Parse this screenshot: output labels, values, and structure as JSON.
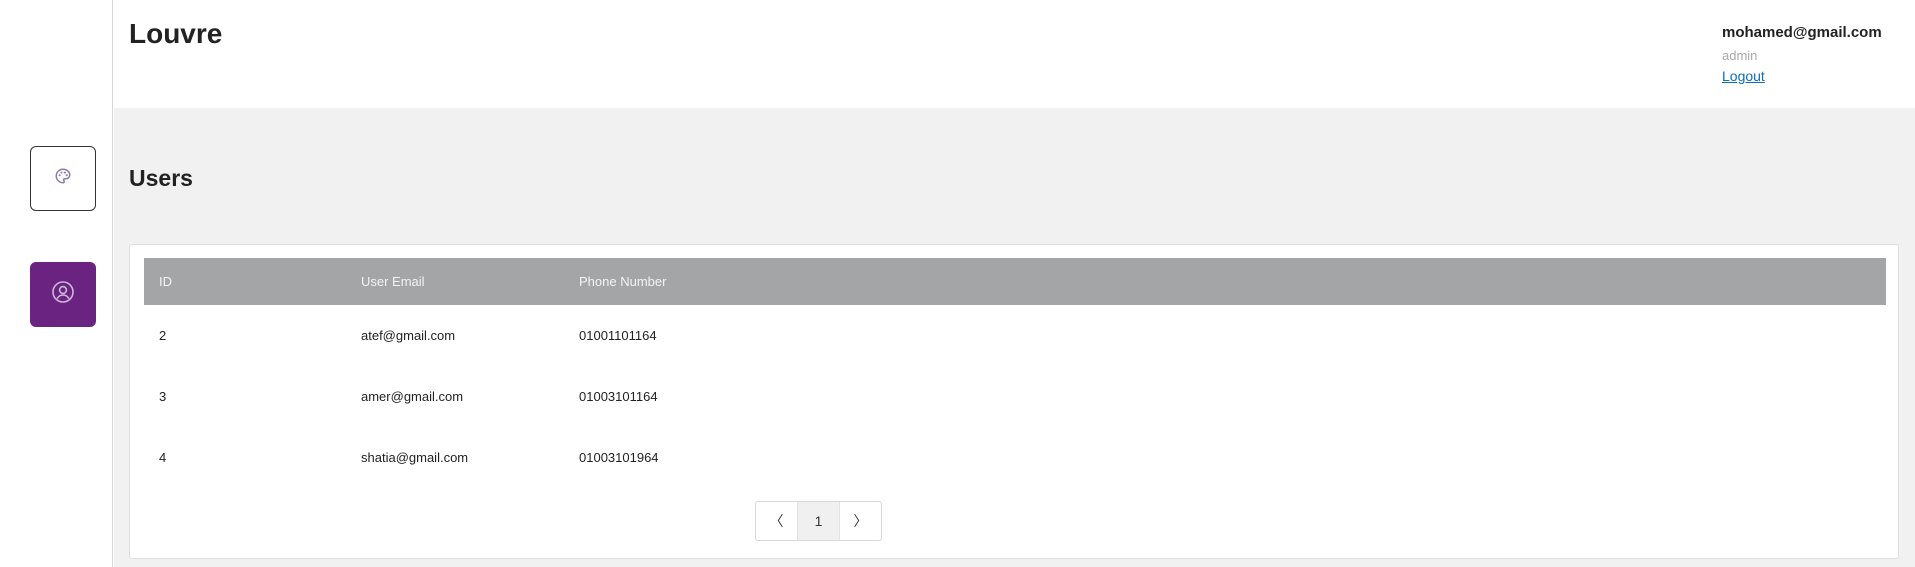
{
  "header": {
    "brand": "Louvre",
    "user_email": "mohamed@gmail.com",
    "user_role": "admin",
    "logout_label": "Logout"
  },
  "sidebar": {
    "items": [
      {
        "icon": "palette-icon",
        "active": false
      },
      {
        "icon": "user-circle-icon",
        "active": true
      }
    ],
    "accent_color": "#6b2382"
  },
  "main": {
    "title": "Users",
    "table": {
      "columns": [
        "ID",
        "User Email",
        "Phone Number"
      ],
      "rows": [
        {
          "id": "2",
          "email": "atef@gmail.com",
          "phone": "01001101164"
        },
        {
          "id": "3",
          "email": "amer@gmail.com",
          "phone": "01003101164"
        },
        {
          "id": "4",
          "email": "shatia@gmail.com",
          "phone": "01003101964"
        }
      ]
    },
    "pagination": {
      "prev": "〈",
      "current_page": "1",
      "next": "〉"
    }
  }
}
